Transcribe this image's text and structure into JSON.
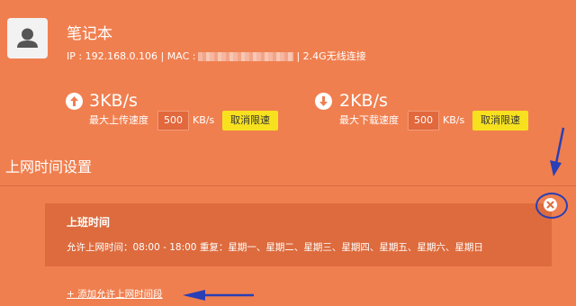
{
  "device": {
    "name": "笔记本",
    "ip_label": "IP : 192.168.0.106 | MAC :",
    "connection": "| 2.4G无线连接",
    "icon": "user-avatar-icon"
  },
  "upload": {
    "value": "3KB/s",
    "label": "最大上传速度",
    "limit": "500",
    "unit": "KB/s",
    "button": "取消限速",
    "icon": "arrow-up-circle-icon"
  },
  "download": {
    "value": "2KB/s",
    "label": "最大下载速度",
    "limit": "500",
    "unit": "KB/s",
    "button": "取消限速",
    "icon": "arrow-down-circle-icon"
  },
  "schedule": {
    "section_title": "上网时间设置",
    "rule_title": "上班时间",
    "rule_detail": "允许上网时间：08:00 - 18:00   重复：星期一、星期二、星期三、星期四、星期五、星期六、星期日",
    "add_link": "+ 添加允许上网时间段"
  },
  "colors": {
    "background": "#f07f4f",
    "card": "#dd6b3d",
    "button": "#f7e11f",
    "annotation": "#2a3fb5"
  }
}
